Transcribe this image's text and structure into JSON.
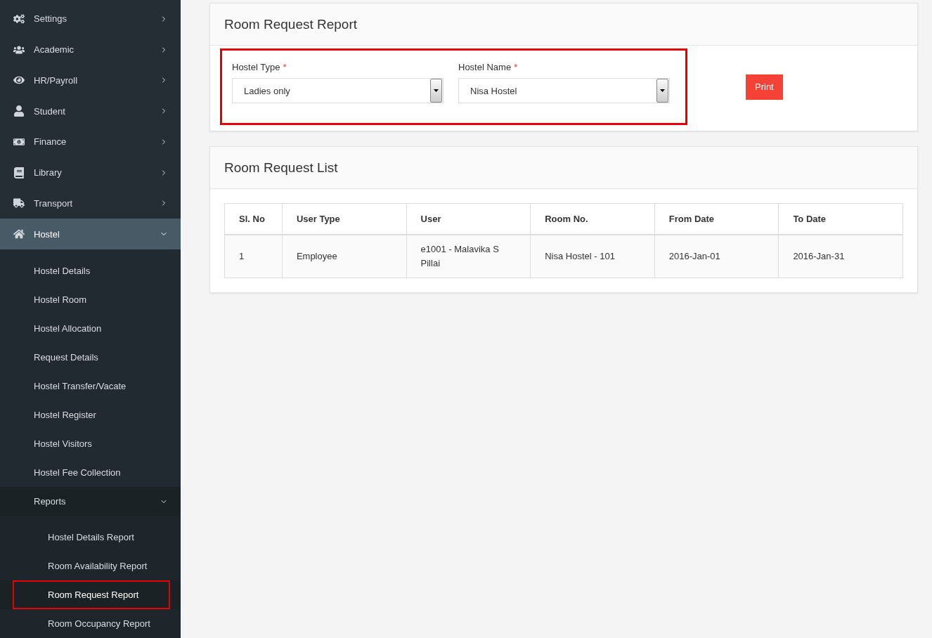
{
  "sidebar": {
    "items": [
      {
        "label": "Settings",
        "expanded": false,
        "selected": false
      },
      {
        "label": "Academic",
        "expanded": false,
        "selected": false
      },
      {
        "label": "HR/Payroll",
        "expanded": false,
        "selected": false
      },
      {
        "label": "Student",
        "expanded": false,
        "selected": false
      },
      {
        "label": "Finance",
        "expanded": false,
        "selected": false
      },
      {
        "label": "Library",
        "expanded": false,
        "selected": false
      },
      {
        "label": "Transport",
        "expanded": false,
        "selected": false
      },
      {
        "label": "Hostel",
        "expanded": true,
        "selected": true,
        "children": [
          {
            "label": "Hostel Details",
            "selected": false
          },
          {
            "label": "Hostel Room",
            "selected": false
          },
          {
            "label": "Hostel Allocation",
            "selected": false
          },
          {
            "label": "Request Details",
            "selected": false
          },
          {
            "label": "Hostel Transfer/Vacate",
            "selected": false
          },
          {
            "label": "Hostel Register",
            "selected": false
          },
          {
            "label": "Hostel Visitors",
            "selected": false
          },
          {
            "label": "Hostel Fee Collection",
            "selected": false
          },
          {
            "label": "Reports",
            "selected": false,
            "expanded": true,
            "children": [
              {
                "label": "Hostel Details Report",
                "selected": false,
                "highlighted": false
              },
              {
                "label": "Room Availability Report",
                "selected": false,
                "highlighted": false
              },
              {
                "label": "Room Request Report",
                "selected": true,
                "highlighted": true
              },
              {
                "label": "Room Occupancy Report",
                "selected": false,
                "highlighted": false
              }
            ]
          }
        ]
      }
    ]
  },
  "report_form": {
    "title": "Room Request Report",
    "highlighted": true,
    "fields": [
      {
        "label": "Hostel Type",
        "required_mark": "*",
        "value": "Ladies only"
      },
      {
        "label": "Hostel Name",
        "required_mark": "*",
        "value": "Nisa Hostel"
      }
    ],
    "print_button": "Print"
  },
  "list": {
    "title": "Room Request List",
    "columns": [
      "Sl. No",
      "User Type",
      "User",
      "Room No.",
      "From Date",
      "To Date"
    ],
    "rows": [
      [
        "1",
        "Employee",
        "e1001 - Malavika S Pillai",
        "Nisa Hostel - 101",
        "2016-Jan-01",
        "2016-Jan-31"
      ]
    ]
  }
}
